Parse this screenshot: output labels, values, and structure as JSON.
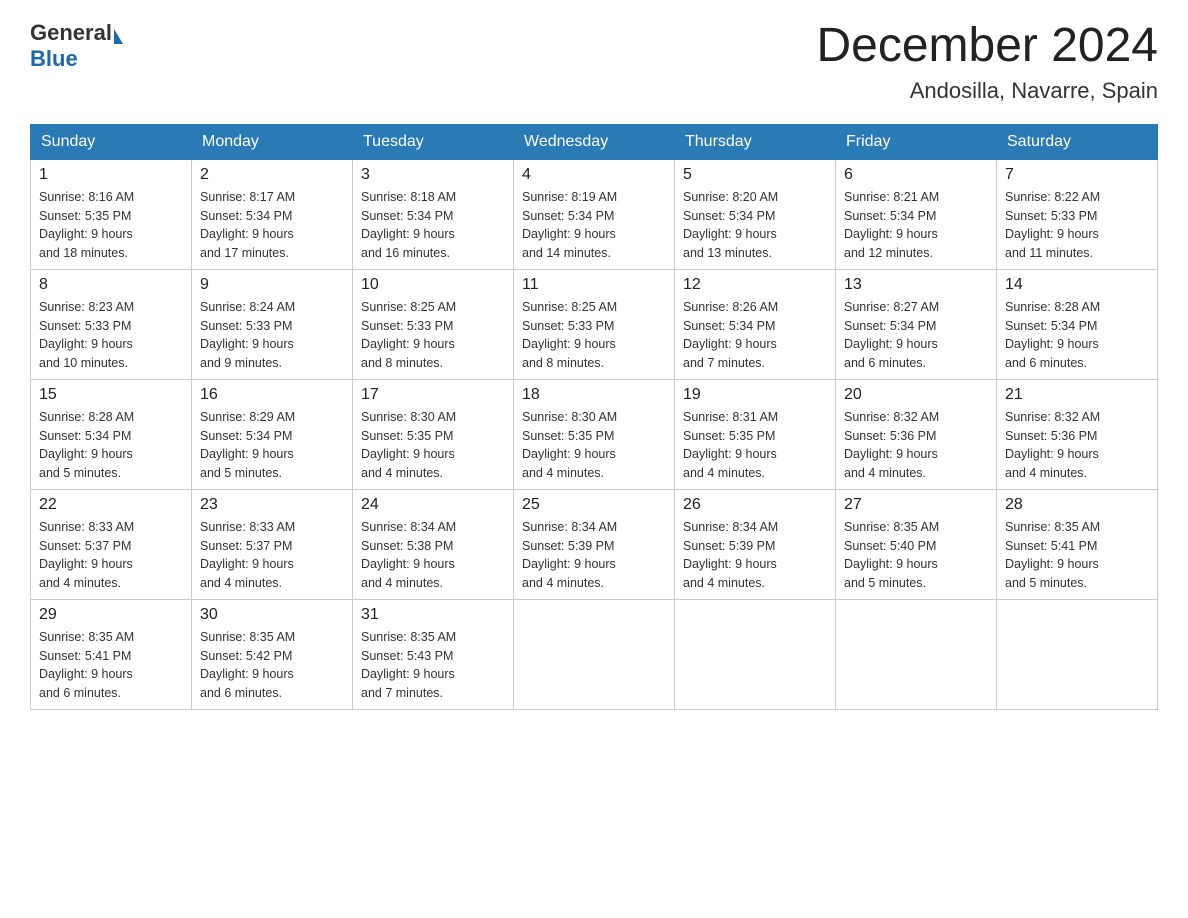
{
  "header": {
    "logo_general": "General",
    "logo_blue": "Blue",
    "month_title": "December 2024",
    "location": "Andosilla, Navarre, Spain"
  },
  "days_of_week": [
    "Sunday",
    "Monday",
    "Tuesday",
    "Wednesday",
    "Thursday",
    "Friday",
    "Saturday"
  ],
  "weeks": [
    [
      {
        "day": "1",
        "sunrise": "8:16 AM",
        "sunset": "5:35 PM",
        "daylight": "9 hours and 18 minutes."
      },
      {
        "day": "2",
        "sunrise": "8:17 AM",
        "sunset": "5:34 PM",
        "daylight": "9 hours and 17 minutes."
      },
      {
        "day": "3",
        "sunrise": "8:18 AM",
        "sunset": "5:34 PM",
        "daylight": "9 hours and 16 minutes."
      },
      {
        "day": "4",
        "sunrise": "8:19 AM",
        "sunset": "5:34 PM",
        "daylight": "9 hours and 14 minutes."
      },
      {
        "day": "5",
        "sunrise": "8:20 AM",
        "sunset": "5:34 PM",
        "daylight": "9 hours and 13 minutes."
      },
      {
        "day": "6",
        "sunrise": "8:21 AM",
        "sunset": "5:34 PM",
        "daylight": "9 hours and 12 minutes."
      },
      {
        "day": "7",
        "sunrise": "8:22 AM",
        "sunset": "5:33 PM",
        "daylight": "9 hours and 11 minutes."
      }
    ],
    [
      {
        "day": "8",
        "sunrise": "8:23 AM",
        "sunset": "5:33 PM",
        "daylight": "9 hours and 10 minutes."
      },
      {
        "day": "9",
        "sunrise": "8:24 AM",
        "sunset": "5:33 PM",
        "daylight": "9 hours and 9 minutes."
      },
      {
        "day": "10",
        "sunrise": "8:25 AM",
        "sunset": "5:33 PM",
        "daylight": "9 hours and 8 minutes."
      },
      {
        "day": "11",
        "sunrise": "8:25 AM",
        "sunset": "5:33 PM",
        "daylight": "9 hours and 8 minutes."
      },
      {
        "day": "12",
        "sunrise": "8:26 AM",
        "sunset": "5:34 PM",
        "daylight": "9 hours and 7 minutes."
      },
      {
        "day": "13",
        "sunrise": "8:27 AM",
        "sunset": "5:34 PM",
        "daylight": "9 hours and 6 minutes."
      },
      {
        "day": "14",
        "sunrise": "8:28 AM",
        "sunset": "5:34 PM",
        "daylight": "9 hours and 6 minutes."
      }
    ],
    [
      {
        "day": "15",
        "sunrise": "8:28 AM",
        "sunset": "5:34 PM",
        "daylight": "9 hours and 5 minutes."
      },
      {
        "day": "16",
        "sunrise": "8:29 AM",
        "sunset": "5:34 PM",
        "daylight": "9 hours and 5 minutes."
      },
      {
        "day": "17",
        "sunrise": "8:30 AM",
        "sunset": "5:35 PM",
        "daylight": "9 hours and 4 minutes."
      },
      {
        "day": "18",
        "sunrise": "8:30 AM",
        "sunset": "5:35 PM",
        "daylight": "9 hours and 4 minutes."
      },
      {
        "day": "19",
        "sunrise": "8:31 AM",
        "sunset": "5:35 PM",
        "daylight": "9 hours and 4 minutes."
      },
      {
        "day": "20",
        "sunrise": "8:32 AM",
        "sunset": "5:36 PM",
        "daylight": "9 hours and 4 minutes."
      },
      {
        "day": "21",
        "sunrise": "8:32 AM",
        "sunset": "5:36 PM",
        "daylight": "9 hours and 4 minutes."
      }
    ],
    [
      {
        "day": "22",
        "sunrise": "8:33 AM",
        "sunset": "5:37 PM",
        "daylight": "9 hours and 4 minutes."
      },
      {
        "day": "23",
        "sunrise": "8:33 AM",
        "sunset": "5:37 PM",
        "daylight": "9 hours and 4 minutes."
      },
      {
        "day": "24",
        "sunrise": "8:34 AM",
        "sunset": "5:38 PM",
        "daylight": "9 hours and 4 minutes."
      },
      {
        "day": "25",
        "sunrise": "8:34 AM",
        "sunset": "5:39 PM",
        "daylight": "9 hours and 4 minutes."
      },
      {
        "day": "26",
        "sunrise": "8:34 AM",
        "sunset": "5:39 PM",
        "daylight": "9 hours and 4 minutes."
      },
      {
        "day": "27",
        "sunrise": "8:35 AM",
        "sunset": "5:40 PM",
        "daylight": "9 hours and 5 minutes."
      },
      {
        "day": "28",
        "sunrise": "8:35 AM",
        "sunset": "5:41 PM",
        "daylight": "9 hours and 5 minutes."
      }
    ],
    [
      {
        "day": "29",
        "sunrise": "8:35 AM",
        "sunset": "5:41 PM",
        "daylight": "9 hours and 6 minutes."
      },
      {
        "day": "30",
        "sunrise": "8:35 AM",
        "sunset": "5:42 PM",
        "daylight": "9 hours and 6 minutes."
      },
      {
        "day": "31",
        "sunrise": "8:35 AM",
        "sunset": "5:43 PM",
        "daylight": "9 hours and 7 minutes."
      },
      null,
      null,
      null,
      null
    ]
  ]
}
